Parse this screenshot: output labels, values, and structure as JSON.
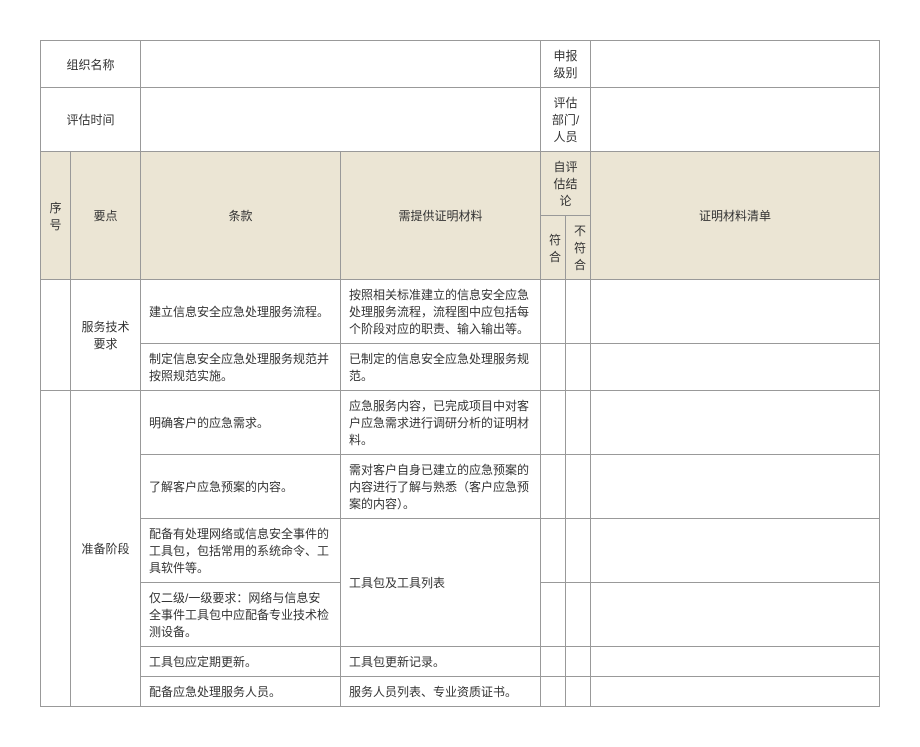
{
  "meta": {
    "org_label": "组织名称",
    "level_label": "申报级别",
    "time_label": "评估时间",
    "dept_label": "评估部门/人员"
  },
  "header": {
    "no": "序号",
    "point": "要点",
    "clause": "条款",
    "evidence": "需提供证明材料",
    "self_eval": "自评估结论",
    "conform": "符合",
    "nonconform": "不符合",
    "list": "证明材料清单"
  },
  "rows": [
    {
      "point": "服务技术要求",
      "clauses": [
        {
          "c": "建立信息安全应急处理服务流程。",
          "e": "按照相关标准建立的信息安全应急处理服务流程，流程图中应包括每个阶段对应的职责、输入输出等。"
        },
        {
          "c": " 制定信息安全应急处理服务规范并按照规范实施。",
          "e": "已制定的信息安全应急处理服务规范。"
        }
      ]
    },
    {
      "point": "准备阶段",
      "clauses": [
        {
          "c": "明确客户的应急需求。",
          "e": "应急服务内容，已完成项目中对客户应急需求进行调研分析的证明材料。"
        },
        {
          "c": "了解客户应急预案的内容。",
          "e": "需对客户自身已建立的应急预案的内容进行了解与熟悉（客户应急预案的内容）。"
        },
        {
          "c": "配备有处理网络或信息安全事件的工具包，包括常用的系统命令、工具软件等。",
          "e": "工具包及工具列表"
        },
        {
          "c": " 仅二级/一级要求：网络与信息安全事件工具包中应配备专业技术检测设备。",
          "e": ""
        },
        {
          "c": "工具包应定期更新。",
          "e": "工具包更新记录。"
        },
        {
          "c": "配备应急处理服务人员。",
          "e": "服务人员列表、专业资质证书。"
        }
      ]
    }
  ]
}
